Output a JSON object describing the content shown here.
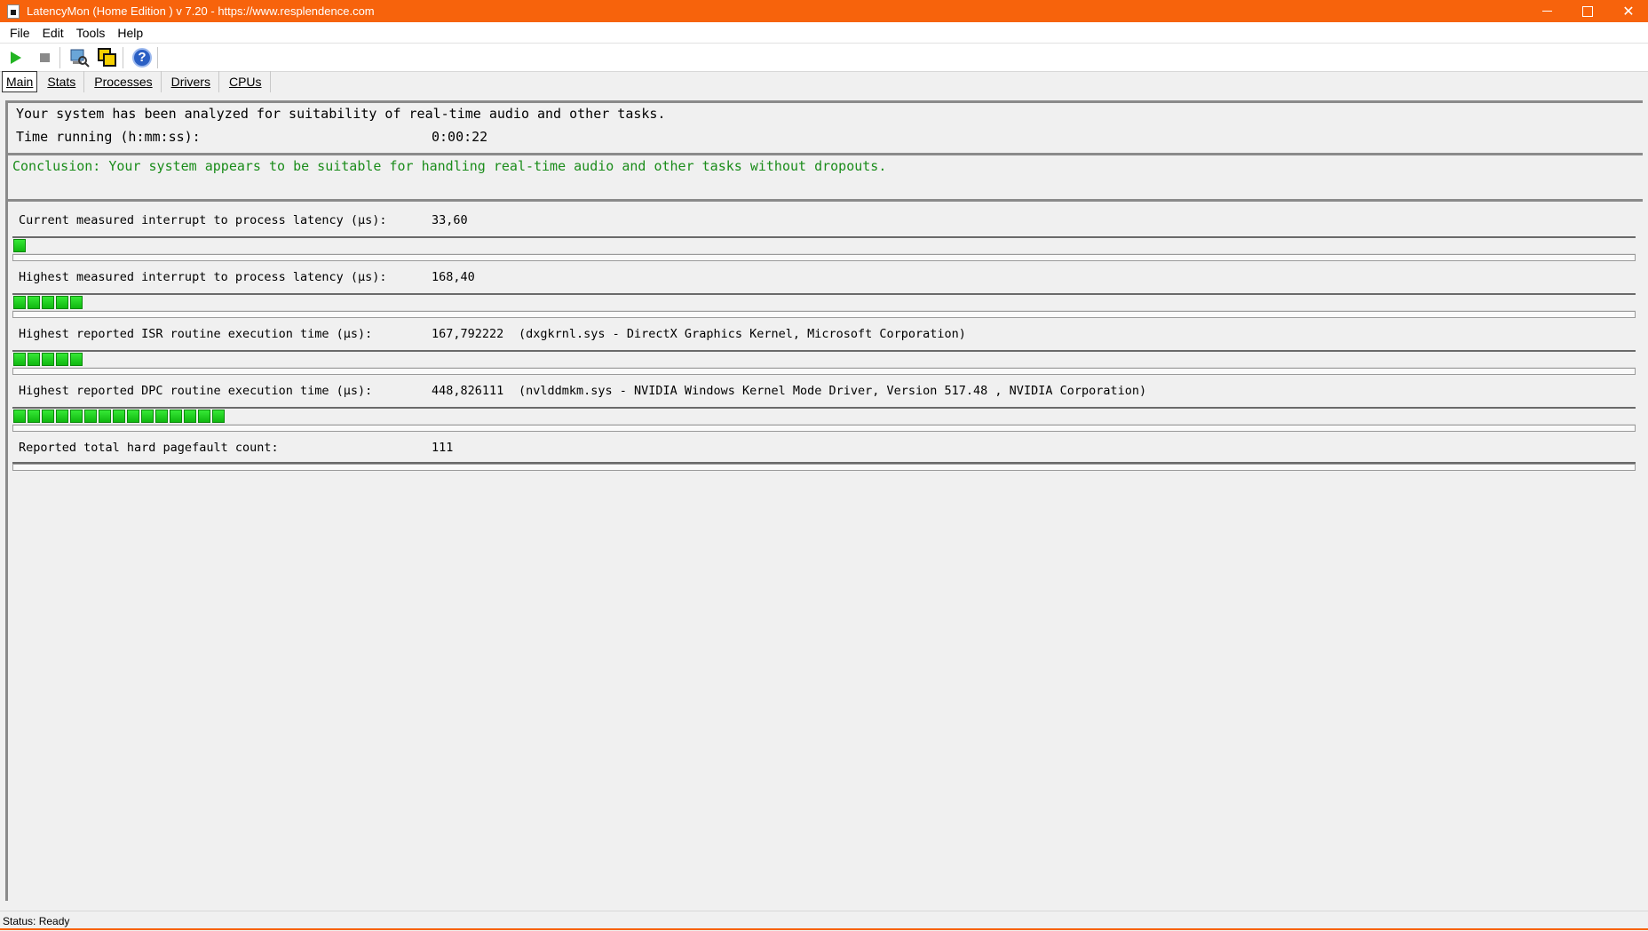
{
  "window": {
    "title": "LatencyMon  (Home Edition )  v 7.20 - https://www.resplendence.com",
    "title_bar_color": "#f7630c"
  },
  "menu": {
    "items": [
      "File",
      "Edit",
      "Tools",
      "Help"
    ]
  },
  "toolbar": {
    "buttons": [
      "play-icon",
      "stop-icon",
      "scan-icon",
      "copy-icon",
      "help-icon"
    ]
  },
  "tabs": [
    "Main",
    "Stats",
    "Processes",
    "Drivers",
    "CPUs"
  ],
  "summary": {
    "analyzed_text": "Your system has been analyzed for suitability of real-time audio and other tasks.",
    "time_label": "Time running (h:mm:ss):",
    "time_value": "0:00:22"
  },
  "conclusion": {
    "text": "Conclusion: Your system appears to be suitable for handling real-time audio and other tasks without dropouts.",
    "color": "#1a8c1a"
  },
  "metrics": [
    {
      "label": "Current measured interrupt to process latency (µs):",
      "value": "33,60",
      "driver": "",
      "segments": 1
    },
    {
      "label": "Highest measured interrupt to process latency (µs):",
      "value": "168,40",
      "driver": "",
      "segments": 5
    },
    {
      "label": "Highest reported ISR routine execution time (µs):",
      "value": "167,792222",
      "driver": "(dxgkrnl.sys - DirectX Graphics Kernel, Microsoft Corporation)",
      "segments": 5
    },
    {
      "label": "Highest reported DPC routine execution time (µs):",
      "value": "448,826111",
      "driver": "(nvlddmkm.sys - NVIDIA Windows Kernel Mode Driver, Version 517.48 , NVIDIA Corporation)",
      "segments": 15
    },
    {
      "label": "Reported total hard pagefault count:",
      "value": "111",
      "driver": "",
      "segments": 0
    }
  ],
  "status": {
    "text": "Status: Ready"
  }
}
